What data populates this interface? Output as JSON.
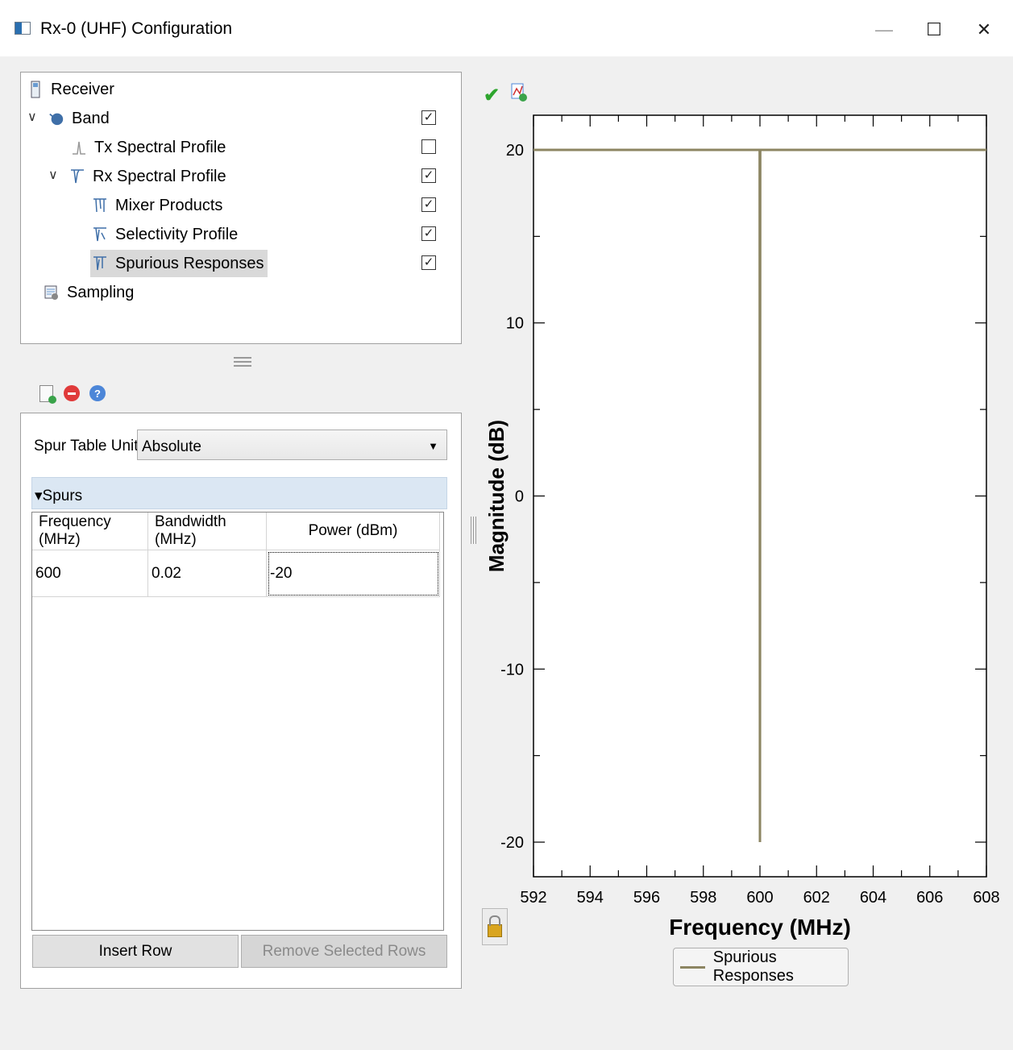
{
  "window": {
    "title": "Rx-0 (UHF) Configuration"
  },
  "tree": {
    "items": [
      {
        "label": "Receiver",
        "icon": "receiver-icon",
        "checked": null
      },
      {
        "label": "Band",
        "icon": "band-icon",
        "checked": true
      },
      {
        "label": "Tx Spectral Profile",
        "icon": "tx-spectral-icon",
        "checked": false
      },
      {
        "label": "Rx Spectral Profile",
        "icon": "rx-spectral-icon",
        "checked": true
      },
      {
        "label": "Mixer Products",
        "icon": "mixer-products-icon",
        "checked": true
      },
      {
        "label": "Selectivity Profile",
        "icon": "selectivity-icon",
        "checked": true
      },
      {
        "label": "Spurious Responses",
        "icon": "spurious-icon",
        "checked": true,
        "selected": true
      },
      {
        "label": "Sampling",
        "icon": "sampling-icon",
        "checked": null
      }
    ]
  },
  "editor": {
    "units_label": "Spur Table Units",
    "units_value": "Absolute",
    "group_title": "Spurs",
    "table": {
      "headers": [
        "Frequency (MHz)",
        "Bandwidth (MHz)",
        "Power (dBm)"
      ],
      "rows": [
        [
          "600",
          "0.02",
          "-20"
        ]
      ]
    },
    "insert_row": "Insert Row",
    "remove_rows": "Remove Selected Rows"
  },
  "chart_data": {
    "type": "line",
    "xlabel": "Frequency (MHz)",
    "ylabel": "Magnitude (dB)",
    "xlim": [
      592,
      608
    ],
    "ylim": [
      -22,
      22
    ],
    "xticks": [
      592,
      594,
      596,
      598,
      600,
      602,
      604,
      606,
      608
    ],
    "yticks": [
      20,
      10,
      0,
      -10,
      -20
    ],
    "series": [
      {
        "name": "Spurious Responses",
        "color": "#8c8562",
        "x": [
          592,
          599.99,
          600,
          600.01,
          608
        ],
        "y": [
          20,
          20,
          -20,
          20,
          20
        ]
      }
    ],
    "legend": "bottom-center",
    "grid": false
  }
}
